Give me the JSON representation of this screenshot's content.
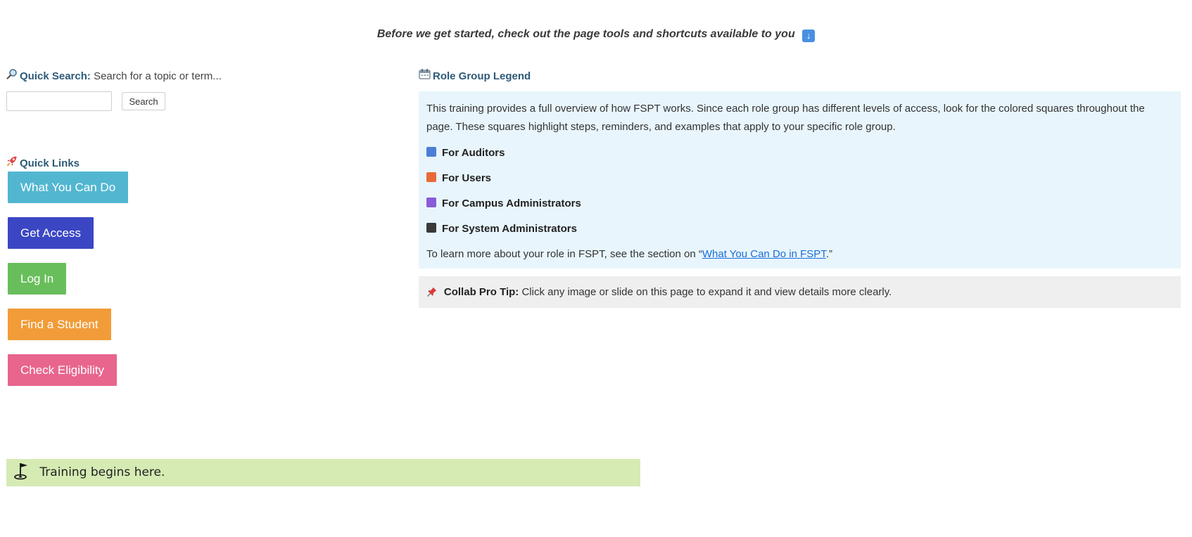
{
  "intro": {
    "text": "Before we get started, check out the page tools and shortcuts available to you",
    "arrow_glyph": "↓"
  },
  "quick_search": {
    "icon": "magnifier-icon",
    "label": "Quick Search:",
    "hint": "Search for a topic or term...",
    "input_value": "",
    "button_label": "Search"
  },
  "quick_links": {
    "icon": "rocket-icon",
    "title": "Quick Links",
    "items": [
      {
        "label": "What You Can Do",
        "color": "#52b6d1"
      },
      {
        "label": "Get Access",
        "color": "#3b46c4"
      },
      {
        "label": "Log In",
        "color": "#69be5c"
      },
      {
        "label": "Find a Student",
        "color": "#f19c38"
      },
      {
        "label": "Check Eligibility",
        "color": "#e8658d"
      }
    ]
  },
  "legend": {
    "icon": "calendar-icon",
    "title": "Role Group Legend",
    "description": "This training provides a full overview of how FSPT works. Since each role group has different levels of access, look for the colored squares throughout the page. These squares highlight steps, reminders, and examples that apply to your specific role group.",
    "roles": [
      {
        "label": "For Auditors",
        "color": "#4a7fd6"
      },
      {
        "label": "For Users",
        "color": "#e8693a"
      },
      {
        "label": "For Campus Administrators",
        "color": "#8a5cd8"
      },
      {
        "label": "For System Administrators",
        "color": "#3a3a3a"
      }
    ],
    "learn_prefix": "To learn more about your role in FSPT, see the section on “",
    "learn_link": "What You Can Do in FSPT",
    "learn_suffix": ".”",
    "background": "#e8f5fc"
  },
  "tip": {
    "icon": "pushpin-icon",
    "label": "Collab Pro Tip:",
    "text": "Click any image or slide on this page to expand it and view details more clearly."
  },
  "banner": {
    "icon": "golf-flag-icon",
    "text": "Training begins here.",
    "background": "#d5ebb3"
  }
}
